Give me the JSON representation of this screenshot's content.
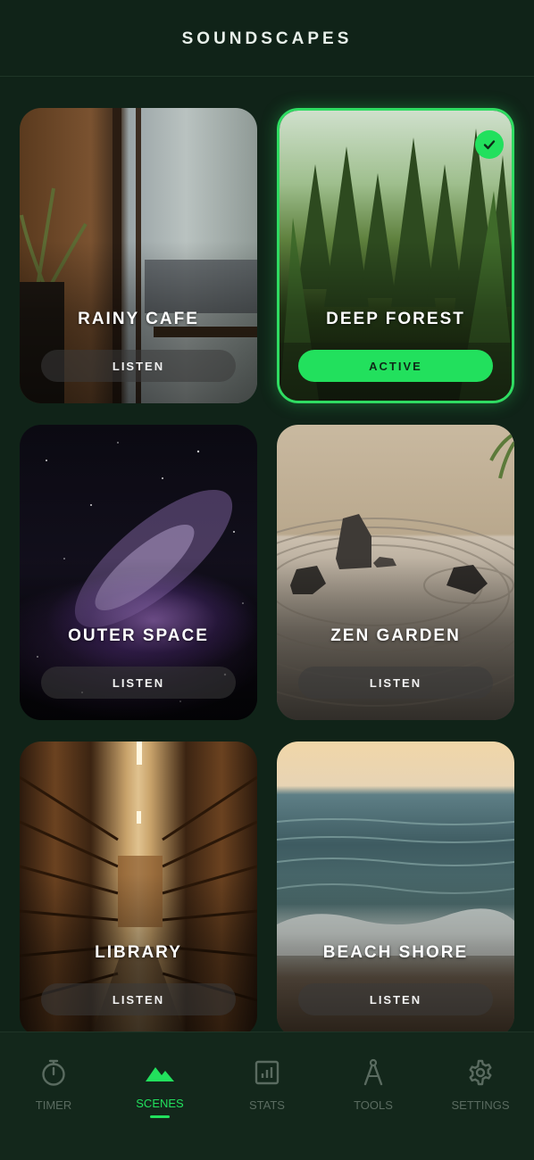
{
  "header": {
    "title": "SOUNDSCAPES"
  },
  "scenes": [
    {
      "name": "RAINY CAFE",
      "button": "LISTEN",
      "active": false
    },
    {
      "name": "DEEP FOREST",
      "button": "ACTIVE",
      "active": true
    },
    {
      "name": "OUTER SPACE",
      "button": "LISTEN",
      "active": false
    },
    {
      "name": "ZEN GARDEN",
      "button": "LISTEN",
      "active": false
    },
    {
      "name": "LIBRARY",
      "button": "LISTEN",
      "active": false
    },
    {
      "name": "BEACH SHORE",
      "button": "LISTEN",
      "active": false
    }
  ],
  "tabs": [
    {
      "label": "TIMER",
      "icon": "stopwatch-icon",
      "active": false
    },
    {
      "label": "SCENES",
      "icon": "mountains-icon",
      "active": true
    },
    {
      "label": "STATS",
      "icon": "bar-chart-icon",
      "active": false
    },
    {
      "label": "TOOLS",
      "icon": "compass-tool-icon",
      "active": false
    },
    {
      "label": "SETTINGS",
      "icon": "gear-icon",
      "active": false
    }
  ],
  "colors": {
    "background": "#102318",
    "accent": "#22e05d",
    "tab_inactive": "#5a6b60"
  }
}
